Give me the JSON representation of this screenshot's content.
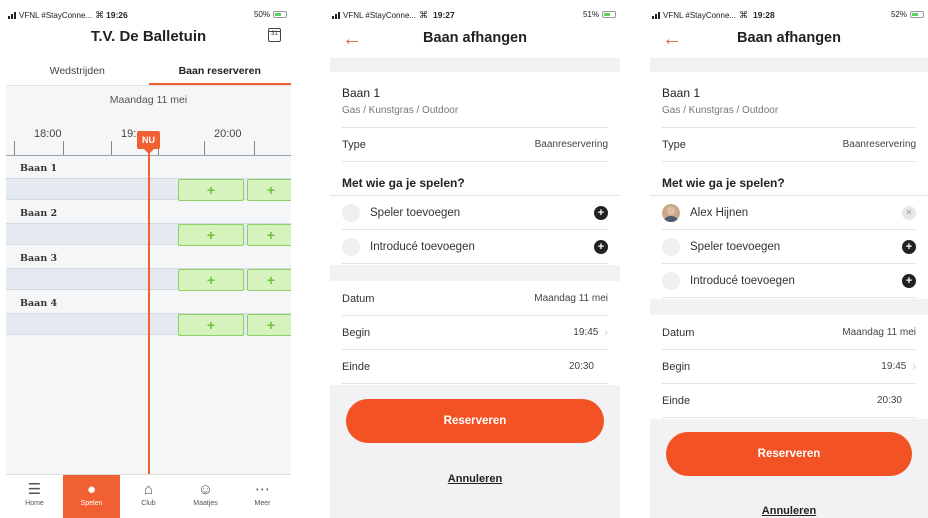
{
  "colors": {
    "accent": "#f06033",
    "slot_fill": "#d6f2bd",
    "slot_plus": "#6cc33a"
  },
  "screen1": {
    "status": {
      "carrier": "VFNL #StayConne...",
      "time": "19:26",
      "battery": "50%"
    },
    "title": "T.V. De Balletuin",
    "calendar_icon_text": "31",
    "tabs": [
      "Wedstrijden",
      "Baan reserveren"
    ],
    "date": "Maandag 11 mei",
    "times": [
      "18:00",
      "19:",
      "20:00"
    ],
    "now_label": "NU",
    "courts": [
      "Baan 1",
      "Baan 2",
      "Baan 3",
      "Baan 4"
    ],
    "slot_symbol": "+",
    "nav": [
      {
        "label": "Home",
        "icon": "home-menu-icon"
      },
      {
        "label": "Spelen",
        "icon": "tennis-ball-icon"
      },
      {
        "label": "Club",
        "icon": "clubhouse-icon"
      },
      {
        "label": "Maatjes",
        "icon": "friends-icon"
      },
      {
        "label": "Meer",
        "icon": "more-dots-icon"
      }
    ]
  },
  "screen2": {
    "status": {
      "carrier": "VFNL #StayConne...",
      "time": "19:27",
      "battery": "51%"
    },
    "title": "Baan afhangen",
    "court": "Baan 1",
    "court_sub": "Gas / Kunstgras / Outdoor",
    "type_label": "Type",
    "type_value": "Baanreservering",
    "players_heading": "Met wie ga je spelen?",
    "add_player": "Speler toevoegen",
    "add_intro": "Introducé toevoegen",
    "date_label": "Datum",
    "date_value": "Maandag 11 mei",
    "begin_label": "Begin",
    "begin_value": "19:45",
    "end_label": "Einde",
    "end_value": "20:30",
    "reserve": "Reserveren",
    "cancel": "Annuleren"
  },
  "screen3": {
    "status": {
      "carrier": "VFNL #StayConne...",
      "time": "19:28",
      "battery": "52%"
    },
    "title": "Baan afhangen",
    "court": "Baan 1",
    "court_sub": "Gas / Kunstgras / Outdoor",
    "type_label": "Type",
    "type_value": "Baanreservering",
    "players_heading": "Met wie ga je spelen?",
    "player_name": "Alex Hijnen",
    "add_player": "Speler toevoegen",
    "add_intro": "Introducé toevoegen",
    "date_label": "Datum",
    "date_value": "Maandag 11 mei",
    "begin_label": "Begin",
    "begin_value": "19:45",
    "end_label": "Einde",
    "end_value": "20:30",
    "reserve": "Reserveren",
    "cancel": "Annuleren"
  }
}
